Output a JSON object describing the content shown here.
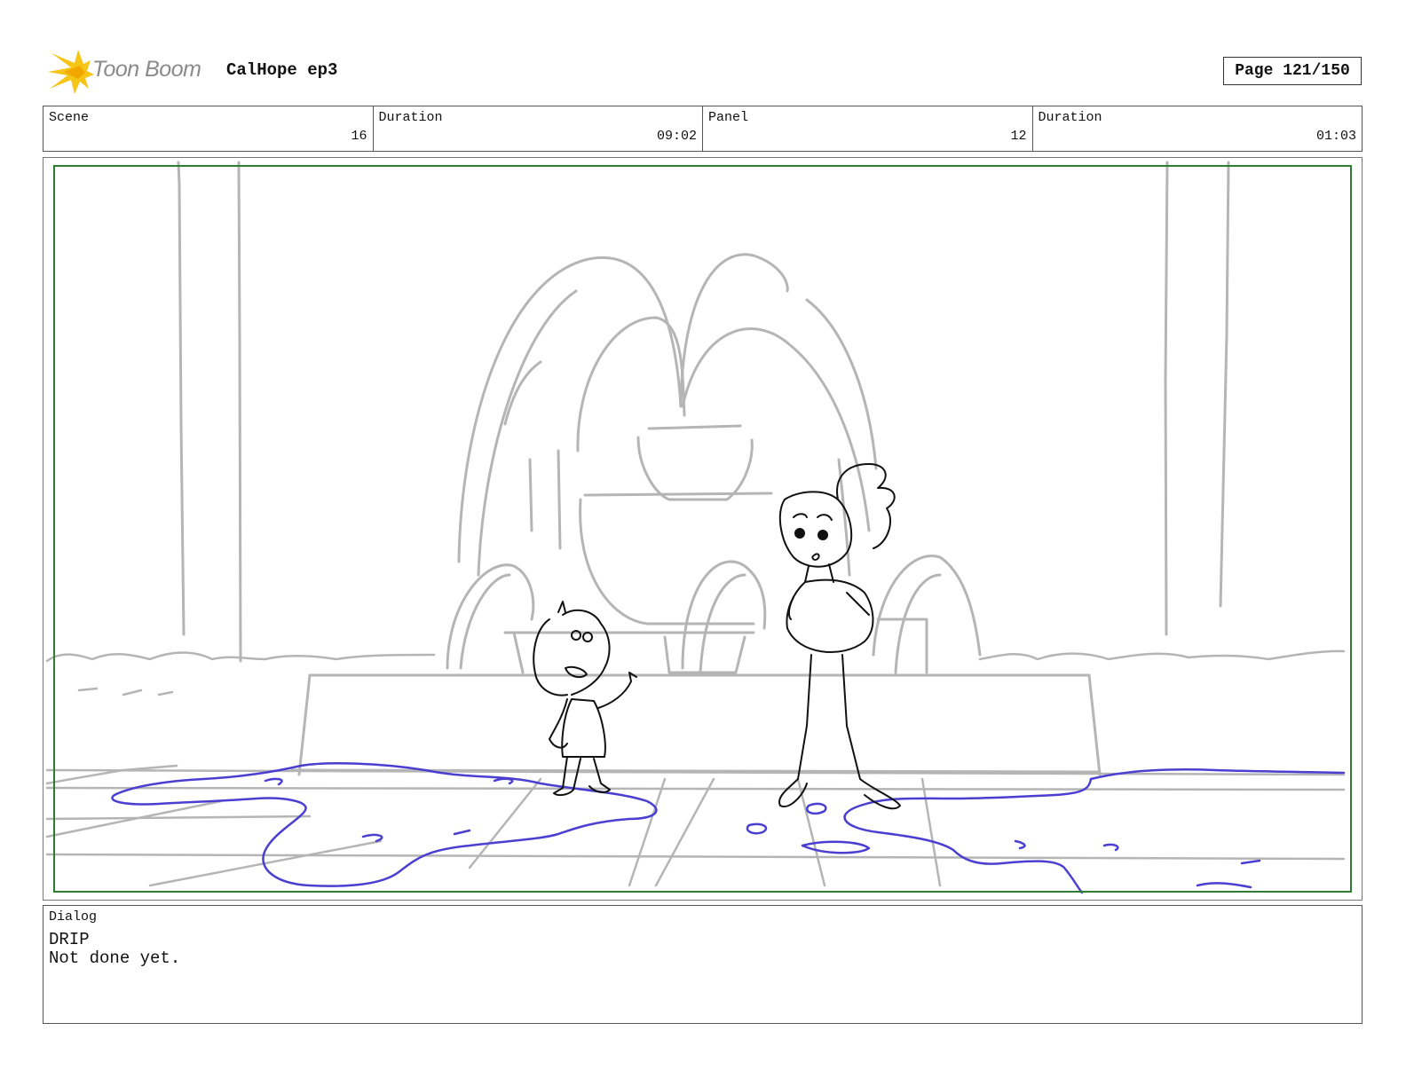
{
  "header": {
    "logo_text": "Toon Boom",
    "title": "CalHope ep3",
    "page": "Page 121/150"
  },
  "info": {
    "scene_label": "Scene",
    "scene_value": "16",
    "scene_duration_label": "Duration",
    "scene_duration_value": "09:02",
    "panel_label": "Panel",
    "panel_value": "12",
    "panel_duration_label": "Duration",
    "panel_duration_value": "01:03"
  },
  "dialog": {
    "label": "Dialog",
    "lines": [
      "DRIP",
      "Not done yet."
    ]
  },
  "colors": {
    "safe_frame": "#2e7d32",
    "water": "#4a3fd0",
    "background_lines": "#b5b5b5",
    "character_lines": "#111111",
    "logo_yellow": "#f5c518"
  }
}
